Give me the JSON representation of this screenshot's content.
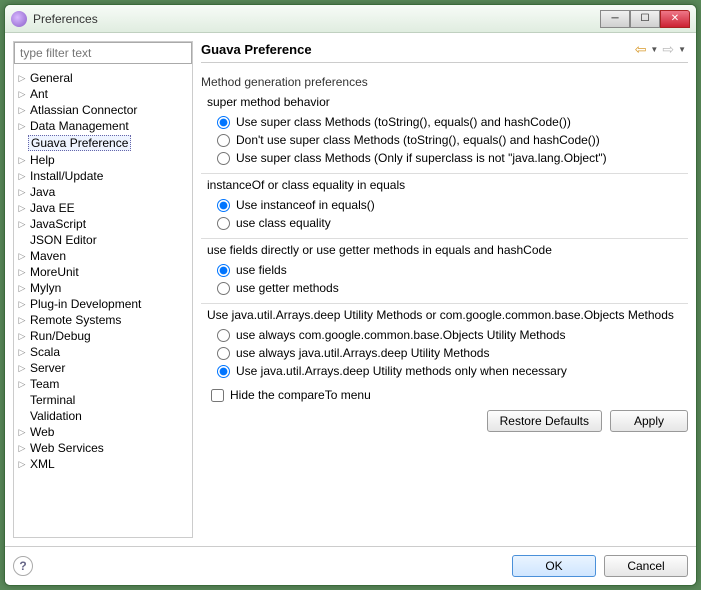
{
  "window": {
    "title": "Preferences"
  },
  "sidebar": {
    "filter_placeholder": "type filter text",
    "items": [
      {
        "label": "General",
        "expandable": true
      },
      {
        "label": "Ant",
        "expandable": true
      },
      {
        "label": "Atlassian Connector",
        "expandable": true
      },
      {
        "label": "Data Management",
        "expandable": true
      },
      {
        "label": "Guava Preference",
        "expandable": false,
        "selected": true
      },
      {
        "label": "Help",
        "expandable": true
      },
      {
        "label": "Install/Update",
        "expandable": true
      },
      {
        "label": "Java",
        "expandable": true
      },
      {
        "label": "Java EE",
        "expandable": true
      },
      {
        "label": "JavaScript",
        "expandable": true
      },
      {
        "label": "JSON Editor",
        "expandable": false
      },
      {
        "label": "Maven",
        "expandable": true
      },
      {
        "label": "MoreUnit",
        "expandable": true
      },
      {
        "label": "Mylyn",
        "expandable": true
      },
      {
        "label": "Plug-in Development",
        "expandable": true
      },
      {
        "label": "Remote Systems",
        "expandable": true
      },
      {
        "label": "Run/Debug",
        "expandable": true
      },
      {
        "label": "Scala",
        "expandable": true
      },
      {
        "label": "Server",
        "expandable": true
      },
      {
        "label": "Team",
        "expandable": true
      },
      {
        "label": "Terminal",
        "expandable": false
      },
      {
        "label": "Validation",
        "expandable": false
      },
      {
        "label": "Web",
        "expandable": true
      },
      {
        "label": "Web Services",
        "expandable": true
      },
      {
        "label": "XML",
        "expandable": true
      }
    ]
  },
  "content": {
    "title": "Guava Preference",
    "intro": "Method generation preferences",
    "groups": [
      {
        "title": "super method behavior",
        "options": [
          {
            "label": "Use super class Methods (toString(), equals() and hashCode())",
            "checked": true
          },
          {
            "label": "Don't use super class Methods (toString(), equals() and hashCode())",
            "checked": false
          },
          {
            "label": "Use super class Methods (Only if superclass is not \"java.lang.Object\")",
            "checked": false
          }
        ]
      },
      {
        "title": "instanceOf or class equality in equals",
        "options": [
          {
            "label": "Use instanceof in equals()",
            "checked": true
          },
          {
            "label": "use class equality",
            "checked": false
          }
        ]
      },
      {
        "title": "use fields directly or use getter methods in equals and hashCode",
        "options": [
          {
            "label": "use fields",
            "checked": true
          },
          {
            "label": "use getter methods",
            "checked": false
          }
        ]
      },
      {
        "title": "Use java.util.Arrays.deep Utility Methods or com.google.common.base.Objects Methods",
        "options": [
          {
            "label": "use always com.google.common.base.Objects Utility Methods",
            "checked": false
          },
          {
            "label": "use always java.util.Arrays.deep Utility Methods",
            "checked": false
          },
          {
            "label": "Use java.util.Arrays.deep Utility methods only when necessary",
            "checked": true
          }
        ]
      }
    ],
    "checkbox": {
      "label": "Hide the compareTo menu",
      "checked": false
    },
    "buttons": {
      "restore": "Restore Defaults",
      "apply": "Apply"
    }
  },
  "footer": {
    "ok": "OK",
    "cancel": "Cancel"
  }
}
